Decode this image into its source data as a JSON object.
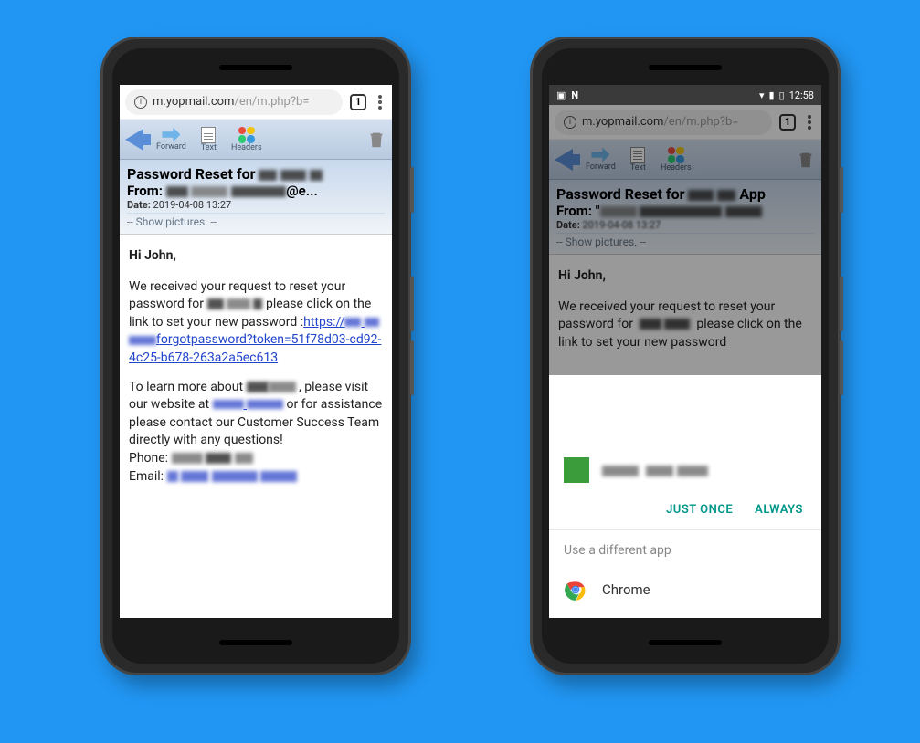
{
  "phone_left": {
    "url": {
      "domain": "m.yopmail.com",
      "path": "/en/m.php?b="
    },
    "tab_count": "1",
    "toolbar": {
      "forward": "Forward",
      "text": "Text",
      "headers": "Headers"
    },
    "email": {
      "subject_prefix": "Password Reset for",
      "from_label": "From:",
      "from_suffix": "@e...",
      "date_label": "Date:",
      "date_value": "2019-04-08 13:27",
      "show_pictures": "-- Show pictures. --",
      "greeting": "Hi John,",
      "p1_a": "We received your request to reset your password for",
      "p1_b": "please click on the link to set your new password :",
      "link_prefix": "https://",
      "link_mid": "forgotpassword?token=51f78d03-cd92-4c25-b678-263a2a5ec613",
      "p2_a": "To learn more about",
      "p2_b": ", please visit our website at",
      "p2_c": "or for assistance please contact our Customer Success Team directly with any questions!",
      "phone_label": "Phone:",
      "email_label": "Email:"
    }
  },
  "phone_right": {
    "statusbar": {
      "time": "12:58"
    },
    "url": {
      "domain": "m.yopmail.com",
      "path": "/en/m.php?b="
    },
    "tab_count": "1",
    "toolbar": {
      "forward": "Forward",
      "text": "Text",
      "headers": "Headers"
    },
    "email": {
      "subject_prefix": "Password Reset for",
      "subject_suffix": "App",
      "from_label": "From:",
      "from_prefix": "\"",
      "date_label": "Date:",
      "date_value": "2019-04-08 13:27",
      "show_pictures": "-- Show pictures. --",
      "greeting": "Hi John,",
      "p1_a": "We received your request to reset your password for",
      "p1_b": "please click on the link to set your new password"
    },
    "chooser": {
      "just_once": "JUST ONCE",
      "always": "ALWAYS",
      "different_app": "Use a different app",
      "chrome": "Chrome"
    }
  }
}
